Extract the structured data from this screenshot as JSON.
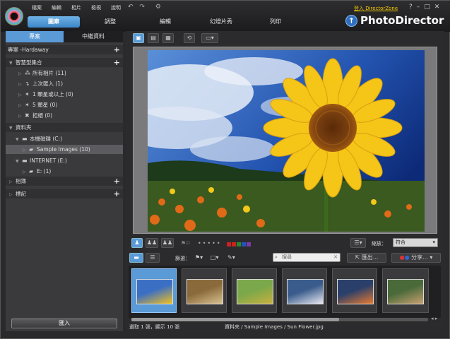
{
  "menu": [
    "檔案",
    "編輯",
    "相片",
    "檢視",
    "說明"
  ],
  "tabs": [
    "圖庫",
    "調整",
    "編輯",
    "幻燈片秀",
    "列印"
  ],
  "login_link": "登入 DirectorZone",
  "window_controls": [
    "?",
    "–",
    "□",
    "✕"
  ],
  "brand": "PhotoDirector",
  "left_tabs": [
    "專案",
    "中繼資料"
  ],
  "project_label": "專案 -Hardaway",
  "smart_collections": {
    "label": "智慧型集合",
    "items": [
      {
        "label": "所有相片 (11)",
        "icon": "all-photos-icon"
      },
      {
        "label": "上次匯入 (1)",
        "icon": "last-import-icon"
      },
      {
        "label": "1 顆星或以上 (0)",
        "icon": "star-icon"
      },
      {
        "label": "5 顆星 (0)",
        "icon": "star-icon"
      },
      {
        "label": "拒絕 (0)",
        "icon": "reject-icon"
      }
    ]
  },
  "folders": {
    "label": "資料夾",
    "drive_c": "本機磁碟 (C:)",
    "sample_images": "Sample Images (10)",
    "drive_e_label": "INTERNET (E:)",
    "drive_e_sub": "E: (1)"
  },
  "albums_label": "相簿",
  "tags_label": "標記",
  "import_button": "匯入",
  "zoom_label": "縮放：",
  "zoom_value": "符合",
  "filter_label": "篩選：",
  "search_placeholder": "搜尋",
  "export_button": "匯出...",
  "share_button": "分享...",
  "color_labels": [
    "#cc2222",
    "#cc2222",
    "#2a8a2a",
    "#2255bb",
    "#7a3aa8"
  ],
  "status_left": "選取 1 張，顯示 10 張",
  "status_path": "資料夾 / Sample Images / Sun Flower.jpg",
  "thumbnails": [
    {
      "name": "sunflower",
      "colors": [
        "#3b6fc4",
        "#f0c020"
      ]
    },
    {
      "name": "shell",
      "colors": [
        "#8a6a3a",
        "#d8c090"
      ]
    },
    {
      "name": "bicycle-field",
      "colors": [
        "#7aa84a",
        "#c8b040"
      ]
    },
    {
      "name": "mountain-lake",
      "colors": [
        "#3a5c8c",
        "#e8e8f0"
      ]
    },
    {
      "name": "sunset",
      "colors": [
        "#2a3f6a",
        "#e87a30"
      ]
    },
    {
      "name": "cat",
      "colors": [
        "#4a6a3a",
        "#c8a070"
      ]
    }
  ]
}
